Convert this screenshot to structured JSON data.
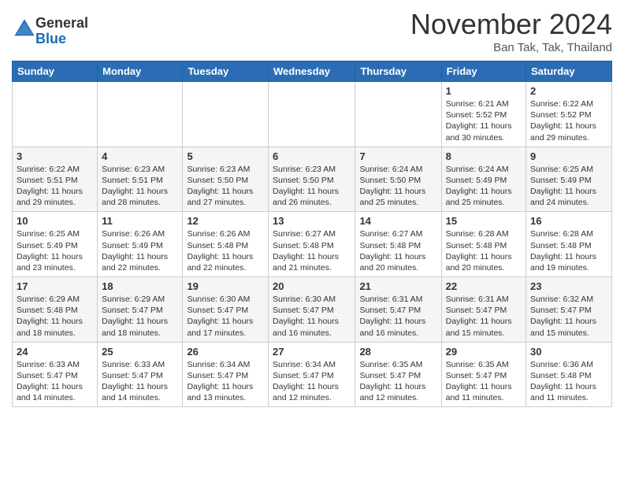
{
  "header": {
    "logo_line1": "General",
    "logo_line2": "Blue",
    "month": "November 2024",
    "location": "Ban Tak, Tak, Thailand"
  },
  "weekdays": [
    "Sunday",
    "Monday",
    "Tuesday",
    "Wednesday",
    "Thursday",
    "Friday",
    "Saturday"
  ],
  "rows": [
    [
      {
        "day": "",
        "info": ""
      },
      {
        "day": "",
        "info": ""
      },
      {
        "day": "",
        "info": ""
      },
      {
        "day": "",
        "info": ""
      },
      {
        "day": "",
        "info": ""
      },
      {
        "day": "1",
        "info": "Sunrise: 6:21 AM\nSunset: 5:52 PM\nDaylight: 11 hours and 30 minutes."
      },
      {
        "day": "2",
        "info": "Sunrise: 6:22 AM\nSunset: 5:52 PM\nDaylight: 11 hours and 29 minutes."
      }
    ],
    [
      {
        "day": "3",
        "info": "Sunrise: 6:22 AM\nSunset: 5:51 PM\nDaylight: 11 hours and 29 minutes."
      },
      {
        "day": "4",
        "info": "Sunrise: 6:23 AM\nSunset: 5:51 PM\nDaylight: 11 hours and 28 minutes."
      },
      {
        "day": "5",
        "info": "Sunrise: 6:23 AM\nSunset: 5:50 PM\nDaylight: 11 hours and 27 minutes."
      },
      {
        "day": "6",
        "info": "Sunrise: 6:23 AM\nSunset: 5:50 PM\nDaylight: 11 hours and 26 minutes."
      },
      {
        "day": "7",
        "info": "Sunrise: 6:24 AM\nSunset: 5:50 PM\nDaylight: 11 hours and 25 minutes."
      },
      {
        "day": "8",
        "info": "Sunrise: 6:24 AM\nSunset: 5:49 PM\nDaylight: 11 hours and 25 minutes."
      },
      {
        "day": "9",
        "info": "Sunrise: 6:25 AM\nSunset: 5:49 PM\nDaylight: 11 hours and 24 minutes."
      }
    ],
    [
      {
        "day": "10",
        "info": "Sunrise: 6:25 AM\nSunset: 5:49 PM\nDaylight: 11 hours and 23 minutes."
      },
      {
        "day": "11",
        "info": "Sunrise: 6:26 AM\nSunset: 5:49 PM\nDaylight: 11 hours and 22 minutes."
      },
      {
        "day": "12",
        "info": "Sunrise: 6:26 AM\nSunset: 5:48 PM\nDaylight: 11 hours and 22 minutes."
      },
      {
        "day": "13",
        "info": "Sunrise: 6:27 AM\nSunset: 5:48 PM\nDaylight: 11 hours and 21 minutes."
      },
      {
        "day": "14",
        "info": "Sunrise: 6:27 AM\nSunset: 5:48 PM\nDaylight: 11 hours and 20 minutes."
      },
      {
        "day": "15",
        "info": "Sunrise: 6:28 AM\nSunset: 5:48 PM\nDaylight: 11 hours and 20 minutes."
      },
      {
        "day": "16",
        "info": "Sunrise: 6:28 AM\nSunset: 5:48 PM\nDaylight: 11 hours and 19 minutes."
      }
    ],
    [
      {
        "day": "17",
        "info": "Sunrise: 6:29 AM\nSunset: 5:48 PM\nDaylight: 11 hours and 18 minutes."
      },
      {
        "day": "18",
        "info": "Sunrise: 6:29 AM\nSunset: 5:47 PM\nDaylight: 11 hours and 18 minutes."
      },
      {
        "day": "19",
        "info": "Sunrise: 6:30 AM\nSunset: 5:47 PM\nDaylight: 11 hours and 17 minutes."
      },
      {
        "day": "20",
        "info": "Sunrise: 6:30 AM\nSunset: 5:47 PM\nDaylight: 11 hours and 16 minutes."
      },
      {
        "day": "21",
        "info": "Sunrise: 6:31 AM\nSunset: 5:47 PM\nDaylight: 11 hours and 16 minutes."
      },
      {
        "day": "22",
        "info": "Sunrise: 6:31 AM\nSunset: 5:47 PM\nDaylight: 11 hours and 15 minutes."
      },
      {
        "day": "23",
        "info": "Sunrise: 6:32 AM\nSunset: 5:47 PM\nDaylight: 11 hours and 15 minutes."
      }
    ],
    [
      {
        "day": "24",
        "info": "Sunrise: 6:33 AM\nSunset: 5:47 PM\nDaylight: 11 hours and 14 minutes."
      },
      {
        "day": "25",
        "info": "Sunrise: 6:33 AM\nSunset: 5:47 PM\nDaylight: 11 hours and 14 minutes."
      },
      {
        "day": "26",
        "info": "Sunrise: 6:34 AM\nSunset: 5:47 PM\nDaylight: 11 hours and 13 minutes."
      },
      {
        "day": "27",
        "info": "Sunrise: 6:34 AM\nSunset: 5:47 PM\nDaylight: 11 hours and 12 minutes."
      },
      {
        "day": "28",
        "info": "Sunrise: 6:35 AM\nSunset: 5:47 PM\nDaylight: 11 hours and 12 minutes."
      },
      {
        "day": "29",
        "info": "Sunrise: 6:35 AM\nSunset: 5:47 PM\nDaylight: 11 hours and 11 minutes."
      },
      {
        "day": "30",
        "info": "Sunrise: 6:36 AM\nSunset: 5:48 PM\nDaylight: 11 hours and 11 minutes."
      }
    ]
  ]
}
